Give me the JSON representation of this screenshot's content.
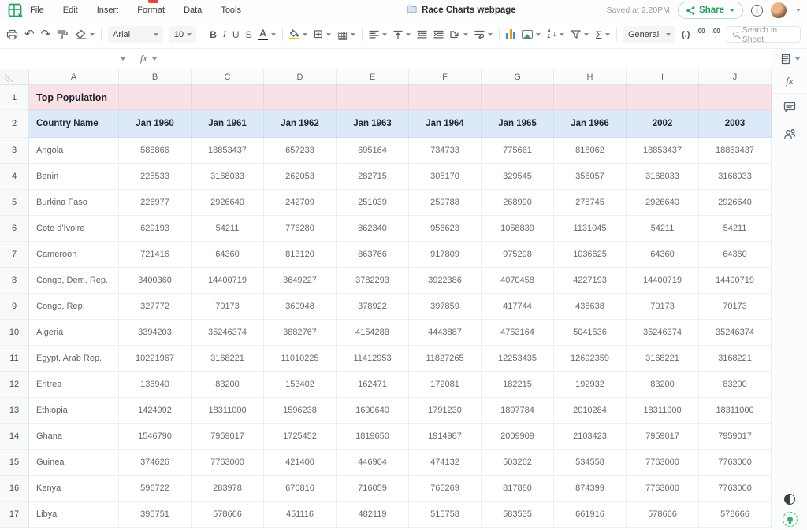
{
  "menu_bar": {
    "menus": [
      "File",
      "Edit",
      "Insert",
      "Format",
      "Data",
      "Tools"
    ],
    "doc_title": "Race Charts webpage",
    "saved_status": "Saved at 2.20PM",
    "share_label": "Share",
    "info_glyph": "i"
  },
  "toolbar": {
    "undo_glyph": "↶",
    "redo_glyph": "↷",
    "font_name": "Arial",
    "font_size": "10",
    "bold": "B",
    "italic": "I",
    "underline": "U",
    "strikethrough": "S",
    "text_color": "A",
    "borders_glyph": "⊞",
    "merge_glyph": "▦",
    "align_glyph": "≡",
    "valign_glyph": "↥",
    "indent_dec_glyph": "⇤",
    "indent_inc_glyph": "⇥",
    "rotate_glyph": "⇗",
    "wrap_glyph": "↩",
    "sort_a": "A",
    "sort_z": "Z",
    "sum": "Σ",
    "number_format": "General",
    "paren_format": "(.)",
    "decimal_label": ".00",
    "decimal_down": "↓",
    "decimal_up": "↑",
    "search_placeholder": "Search in Sheet"
  },
  "formula_bar": {
    "fx_label": "fx"
  },
  "sidebar": {
    "fx_label": "fx"
  },
  "colors": {
    "accent_green": "#1da15a",
    "title_row_bg": "#f8e1e7",
    "header_row_bg": "#dce9f8",
    "chart_bar_blue": "#4285f4",
    "chart_bar_orange": "#f29900",
    "decimal_down_red": "#e8453c",
    "decimal_up_green": "#34a853",
    "text_color_bar": "#202124",
    "fill_color_bar": "#f5c518"
  },
  "sheet": {
    "column_letters": [
      "A",
      "B",
      "C",
      "D",
      "E",
      "F",
      "G",
      "H",
      "I",
      "J"
    ],
    "title_row": {
      "number": "1",
      "title": "Top Population"
    },
    "header_row": {
      "number": "2",
      "cells": [
        "Country Name",
        "Jan 1960",
        "Jan 1961",
        "Jan 1962",
        "Jan 1963",
        "Jan 1964",
        "Jan 1965",
        "Jan 1966",
        "2002",
        "2003"
      ]
    },
    "data_rows": [
      {
        "number": "3",
        "cells": [
          "Angola",
          "588866",
          "18853437",
          "657233",
          "695164",
          "734733",
          "775661",
          "818062",
          "18853437",
          "18853437"
        ]
      },
      {
        "number": "4",
        "cells": [
          "Benin",
          "225533",
          "3168033",
          "262053",
          "282715",
          "305170",
          "329545",
          "356057",
          "3168033",
          "3168033"
        ]
      },
      {
        "number": "5",
        "cells": [
          "Burkina Faso",
          "226977",
          "2926640",
          "242709",
          "251039",
          "259788",
          "268990",
          "278745",
          "2926640",
          "2926640"
        ]
      },
      {
        "number": "6",
        "cells": [
          "Cote d'Ivoire",
          "629193",
          "54211",
          "776280",
          "862340",
          "956623",
          "1058839",
          "1131045",
          "54211",
          "54211"
        ]
      },
      {
        "number": "7",
        "cells": [
          "Cameroon",
          "721416",
          "64360",
          "813120",
          "863766",
          "917809",
          "975298",
          "1036625",
          "64360",
          "64360"
        ]
      },
      {
        "number": "8",
        "cells": [
          "Congo, Dem. Rep.",
          "3400360",
          "14400719",
          "3649227",
          "3782293",
          "3922386",
          "4070458",
          "4227193",
          "14400719",
          "14400719"
        ]
      },
      {
        "number": "9",
        "cells": [
          "Congo, Rep.",
          "327772",
          "70173",
          "360948",
          "378922",
          "397859",
          "417744",
          "438638",
          "70173",
          "70173"
        ]
      },
      {
        "number": "10",
        "cells": [
          "Algeria",
          "3394203",
          "35246374",
          "3882767",
          "4154288",
          "4443887",
          "4753164",
          "5041536",
          "35246374",
          "35246374"
        ]
      },
      {
        "number": "11",
        "cells": [
          "Egypt, Arab Rep.",
          "10221967",
          "3168221",
          "11010225",
          "11412953",
          "11827265",
          "12253435",
          "12692359",
          "3168221",
          "3168221"
        ]
      },
      {
        "number": "12",
        "cells": [
          "Eritrea",
          "136940",
          "83200",
          "153402",
          "162471",
          "172081",
          "182215",
          "192932",
          "83200",
          "83200"
        ]
      },
      {
        "number": "13",
        "cells": [
          "Ethiopia",
          "1424992",
          "18311000",
          "1596238",
          "1690640",
          "1791230",
          "1897784",
          "2010284",
          "18311000",
          "18311000"
        ]
      },
      {
        "number": "14",
        "cells": [
          "Ghana",
          "1546790",
          "7959017",
          "1725452",
          "1819650",
          "1914987",
          "2009909",
          "2103423",
          "7959017",
          "7959017"
        ]
      },
      {
        "number": "15",
        "cells": [
          "Guinea",
          "374626",
          "7763000",
          "421400",
          "446904",
          "474132",
          "503262",
          "534558",
          "7763000",
          "7763000"
        ]
      },
      {
        "number": "16",
        "cells": [
          "Kenya",
          "596722",
          "283978",
          "670816",
          "716059",
          "765269",
          "817880",
          "874399",
          "7763000",
          "7763000"
        ]
      },
      {
        "number": "17",
        "cells": [
          "Libya",
          "395751",
          "578666",
          "451116",
          "482119",
          "515758",
          "583535",
          "661916",
          "578666",
          "578666"
        ]
      }
    ]
  }
}
